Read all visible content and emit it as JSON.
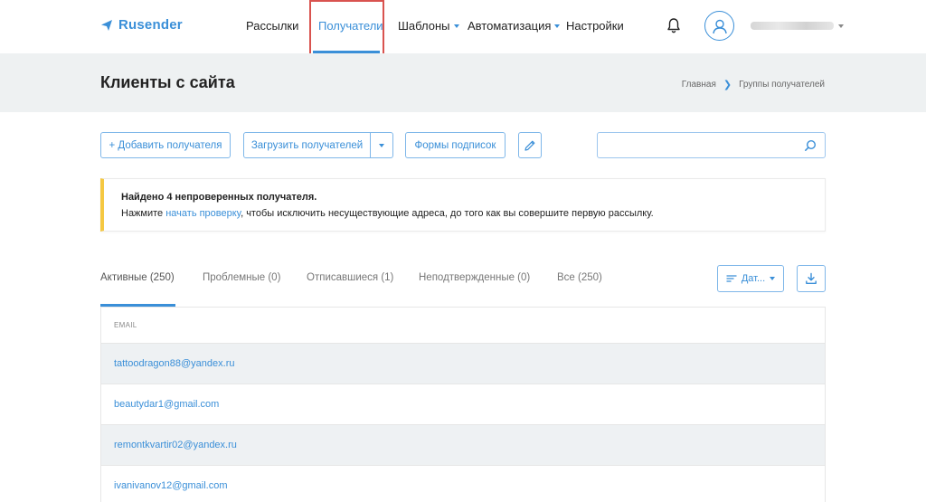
{
  "brand": {
    "name": "Rusender",
    "accent": "#3a8fd8",
    "highlight": "#d9534f",
    "warning": "#f5c842"
  },
  "nav": {
    "items": [
      {
        "label": "Рассылки",
        "has_caret": false
      },
      {
        "label": "Получатели",
        "has_caret": false,
        "active": true
      },
      {
        "label": "Шаблоны",
        "has_caret": true
      },
      {
        "label": "Автоматизация",
        "has_caret": true
      },
      {
        "label": "Настройки",
        "has_caret": false
      }
    ],
    "icons": [
      "bell-icon",
      "user-avatar-icon"
    ]
  },
  "header": {
    "title": "Клиенты с сайта",
    "breadcrumb": [
      "Главная",
      "Группы получателей"
    ]
  },
  "toolbar": {
    "add_label": "+ Добавить получателя",
    "upload_label": "Загрузить получателей",
    "forms_label": "Формы подписок",
    "search_placeholder": ""
  },
  "alert": {
    "title": "Найдено 4 непроверенных получателя.",
    "text_before": "Нажмите ",
    "link": "начать проверку",
    "text_after": ", чтобы исключить несуществующие адреса, до того как вы совершите первую рассылку."
  },
  "tabs": [
    {
      "label": "Активные (250)",
      "active": true
    },
    {
      "label": "Проблемные (0)"
    },
    {
      "label": "Отписавшиеся (1)"
    },
    {
      "label": "Неподтвержденные (0)"
    },
    {
      "label": "Все (250)"
    }
  ],
  "sort": {
    "label": "Дат..."
  },
  "table": {
    "column": "EMAIL",
    "rows": [
      "tattoodragon88@yandex.ru",
      "beautydar1@gmail.com",
      "remontkvartir02@yandex.ru",
      "ivanivanov12@gmail.com"
    ]
  }
}
